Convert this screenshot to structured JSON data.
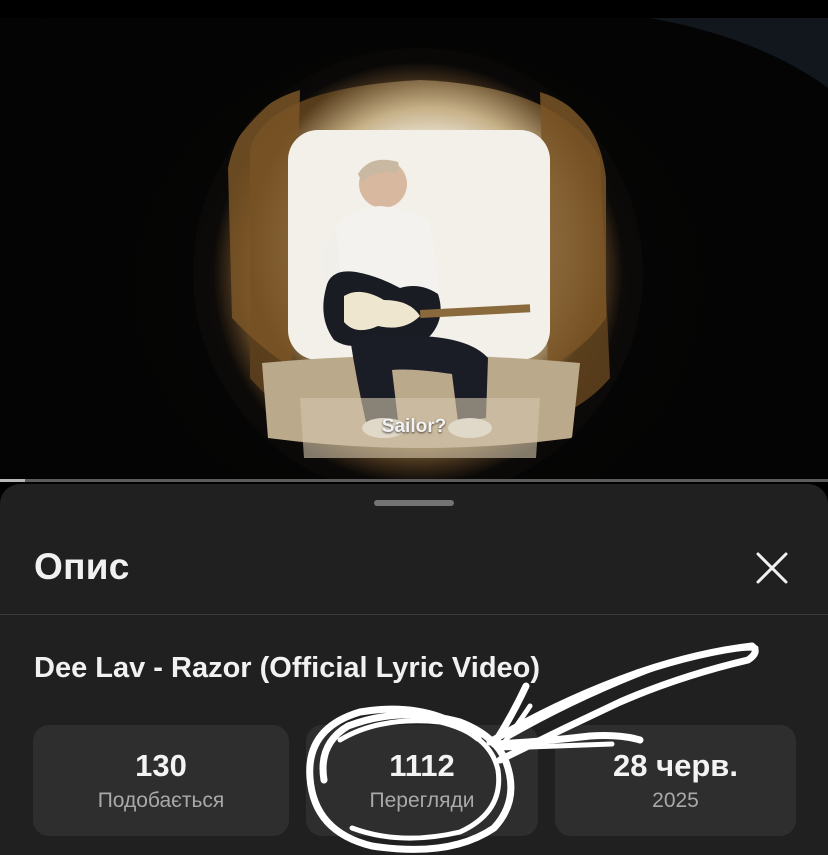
{
  "video": {
    "subtitle": "Sailor?",
    "progress": 0.03
  },
  "sheet": {
    "title": "Опис",
    "close_icon": "close-icon",
    "video_title": "Dee Lav - Razor (Official Lyric Video)",
    "stats": [
      {
        "value": "130",
        "label": "Подобається"
      },
      {
        "value": "1112",
        "label": "Перегляди"
      },
      {
        "value": "28 черв.",
        "label": "2025"
      }
    ]
  },
  "annotation": {
    "type": "hand-drawn circle and arrow",
    "color": "#ffffff",
    "target": "views"
  },
  "colors": {
    "sheet_bg": "#202020",
    "card_bg": "#2e2e2e",
    "label": "#a9a9a9"
  }
}
